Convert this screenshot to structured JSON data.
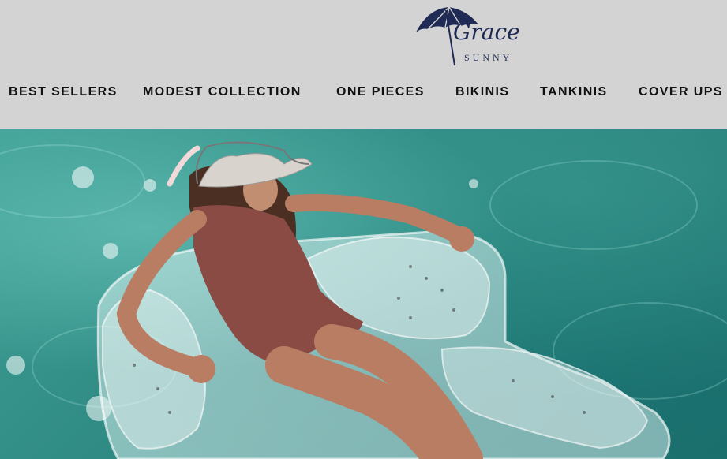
{
  "brand": {
    "script": "Grace",
    "sub": "SUNNY",
    "icon": "beach-umbrella-icon",
    "color": "#1f2a55"
  },
  "nav": {
    "items": [
      {
        "label": "BEST SELLERS"
      },
      {
        "label": "MODEST COLLECTION"
      },
      {
        "label": "ONE PIECES"
      },
      {
        "label": "BIKINIS"
      },
      {
        "label": "TANKINIS"
      },
      {
        "label": "COVER UPS"
      }
    ]
  },
  "hero": {
    "alt": "",
    "water_color": "#2f8b84",
    "swimsuit_color": "#8a4b45"
  }
}
